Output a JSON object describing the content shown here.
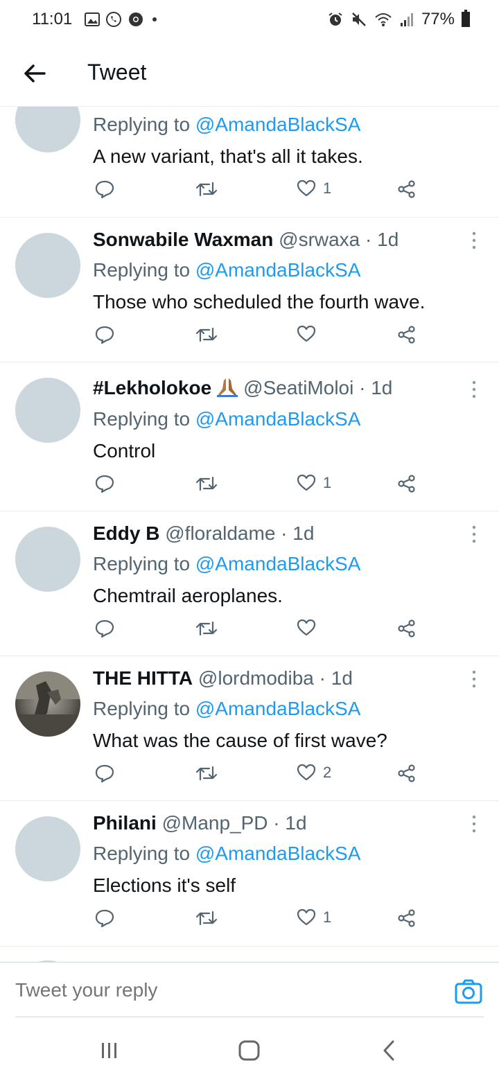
{
  "status_bar": {
    "time": "11:01",
    "battery": "77%",
    "left_icons": [
      "gallery-icon",
      "whatsapp-icon",
      "chrome-icon",
      "dot-icon"
    ],
    "right_icons": [
      "alarm-icon",
      "mute-icon",
      "wifi-icon",
      "signal-icon",
      "battery-icon"
    ]
  },
  "header": {
    "title": "Tweet"
  },
  "colors": {
    "accent": "#1d9bf0",
    "secondary_text": "#536471",
    "avatar_placeholder": "#ccd6dd"
  },
  "tweets": [
    {
      "name": "",
      "handle": "",
      "age": "",
      "replying_prefix": "Replying to ",
      "mention": "@AmandaBlackSA",
      "text": "A new variant, that's all it takes.",
      "likes": "1"
    },
    {
      "name": "Sonwabile Waxman",
      "handle": "@srwaxa",
      "age": " · 1d",
      "replying_prefix": "Replying to ",
      "mention": "@AmandaBlackSA",
      "text": "Those who scheduled the fourth wave.",
      "likes": ""
    },
    {
      "name": "#Lekholokoe",
      "handle": "@SeatiMoloi",
      "age": " · 1d",
      "replying_prefix": "Replying to ",
      "mention": "@AmandaBlackSA",
      "text": "Control",
      "likes": "1"
    },
    {
      "name": "Eddy B",
      "handle": "@floraldame",
      "age": " · 1d",
      "replying_prefix": "Replying to ",
      "mention": "@AmandaBlackSA",
      "text": "Chemtrail aeroplanes.",
      "likes": ""
    },
    {
      "name": "THE HITTA",
      "handle": "@lordmodiba",
      "age": " · 1d",
      "replying_prefix": "Replying to ",
      "mention": "@AmandaBlackSA",
      "text": "What was the cause of first wave?",
      "likes": "2"
    },
    {
      "name": "Philani",
      "handle": "@Manp_PD",
      "age": " · 1d",
      "replying_prefix": "Replying to ",
      "mention": "@AmandaBlackSA",
      "text": "Elections it's self",
      "likes": "1"
    }
  ],
  "reply": {
    "placeholder": "Tweet your reply"
  }
}
